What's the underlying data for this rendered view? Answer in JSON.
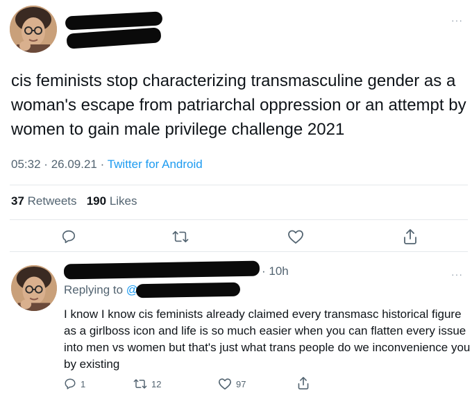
{
  "main_tweet": {
    "text": "cis feminists stop characterizing transmasculine gender as a woman's escape from patriarchal oppression or an attempt by women to gain male privilege challenge 2021",
    "time": "05:32",
    "date": "26.09.21",
    "separator": "·",
    "source": "Twitter for Android",
    "retweets_count": "37",
    "retweets_label": "Retweets",
    "likes_count": "190",
    "likes_label": "Likes",
    "more_icon": "more-horizontal-icon"
  },
  "reply_tweet": {
    "time": "· 10h",
    "replying_to_label": "Replying to",
    "replying_to_at": "@",
    "text": "I know I know cis feminists already claimed every transmasc historical figure as a girlboss icon and life is so much easier when you can flatten every issue into men vs women but that's just what trans people do we inconvenience you by existing",
    "replies_count": "1",
    "retweets_count": "12",
    "likes_count": "97"
  },
  "colors": {
    "text": "#0f1419",
    "muted": "#536471",
    "link": "#1d9bf0",
    "divider": "#e4e8eb",
    "redaction": "#0a0a0a"
  }
}
